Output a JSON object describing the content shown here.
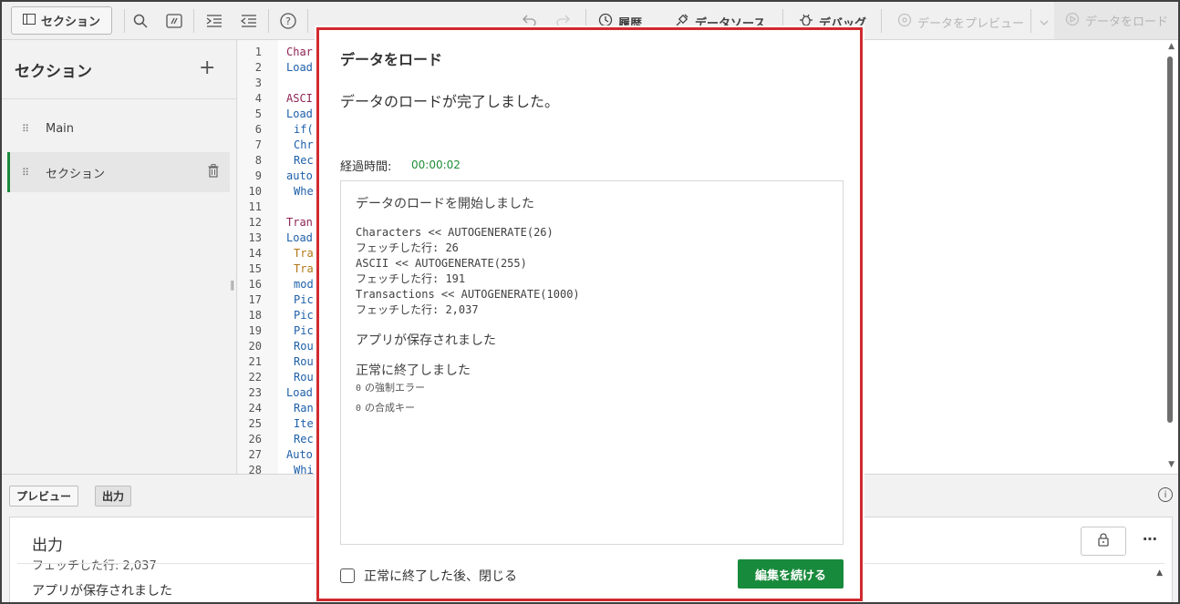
{
  "toolbar": {
    "section_label": "セクション",
    "history_label": "履歴",
    "datasource_label": "データソース",
    "debug_label": "デバッグ",
    "preview_data_label": "データをプレビュー",
    "load_data_label": "データをロード"
  },
  "sidebar": {
    "title": "セクション",
    "add_symbol": "+",
    "items": [
      {
        "label": "Main"
      },
      {
        "label": "セクション"
      }
    ]
  },
  "editor": {
    "line_numbers": [
      "1",
      "2",
      "3",
      "4",
      "5",
      "6",
      "7",
      "8",
      "9",
      "10",
      "11",
      "12",
      "13",
      "14",
      "15",
      "16",
      "17",
      "18",
      "19",
      "20",
      "21",
      "22",
      "23",
      "24",
      "25",
      "26",
      "27",
      "28"
    ],
    "lines": [
      "Char",
      "Load",
      "",
      "ASCI",
      "Load",
      "if(",
      "Chr",
      "Rec",
      "auto",
      "Whe",
      "",
      "Tran",
      "Load",
      "Tra",
      "Tra",
      "mod",
      "Pic",
      "Pic",
      "Pic",
      "Rou",
      "Rou",
      "Rou",
      "Load",
      "Ran",
      "Ite",
      "Rec",
      "Auto",
      "Whi"
    ]
  },
  "bottom": {
    "tab_preview": "プレビュー",
    "tab_output": "出力",
    "output_title": "出力",
    "output_cut_line": "フェッチした行: 2,037",
    "output_line": "アプリが保存されました"
  },
  "dialog": {
    "title": "データをロード",
    "message": "データのロードが完了しました。",
    "elapsed_label": "経過時間:",
    "elapsed_value": "00:00:02",
    "log": {
      "start": "データのロードを開始しました",
      "entries": "Characters << AUTOGENERATE(26)\nフェッチした行: 26\nASCII << AUTOGENERATE(255)\nフェッチした行: 191\nTransactions << AUTOGENERATE(1000)\nフェッチした行: 2,037",
      "saved": "アプリが保存されました",
      "finished": "正常に終了しました",
      "errors_count": "0",
      "errors_label": "の強制エラー",
      "keys_count": "0",
      "keys_label": "の合成キー"
    },
    "close_checkbox_label": "正常に終了した後、閉じる",
    "continue_button": "編集を続ける"
  },
  "colors": {
    "accent_green": "#188a3c",
    "highlight_red": "#d12a2f"
  }
}
